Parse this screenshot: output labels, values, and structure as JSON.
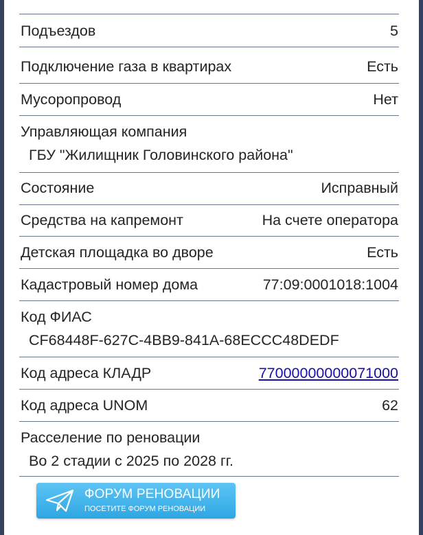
{
  "rows": [
    {
      "label": "Подъездов",
      "value": "5"
    },
    {
      "label": "Подключение газа в квартирах",
      "value": "Есть"
    },
    {
      "label": "Мусоропровод",
      "value": "Нет"
    },
    {
      "label": "Управляющая компания",
      "value": "ГБУ \"Жилищник Головинского района\""
    },
    {
      "label": "Состояние",
      "value": "Исправный"
    },
    {
      "label": "Средства на капремонт",
      "value": "На счете оператора"
    },
    {
      "label": "Детская площадка во дворе",
      "value": "Есть"
    },
    {
      "label": "Кадастровый номер дома",
      "value": "77:09:0001018:1004"
    },
    {
      "label": "Код ФИАС",
      "value": "CF68448F-627C-4BB9-841A-68ECCC48DEDF"
    },
    {
      "label": "Код адреса КЛАДР",
      "value": "77000000000071000"
    },
    {
      "label": "Код адреса UNOM",
      "value": "62"
    },
    {
      "label": "Расселение по реновации",
      "value": "Во 2 стадии с 2025 по 2028 гг."
    }
  ],
  "forum_button": {
    "title": "ФОРУМ РЕНОВАЦИИ",
    "subtitle": "ПОСЕТИТЕ ФОРУМ РЕНОВАЦИИ",
    "icon": "paper-plane-icon"
  },
  "colors": {
    "background": "#34415f",
    "card": "#ffffff",
    "divider": "#6b7592",
    "text": "#242424",
    "link": "#1a0dab",
    "button": "#3ab0e8"
  }
}
